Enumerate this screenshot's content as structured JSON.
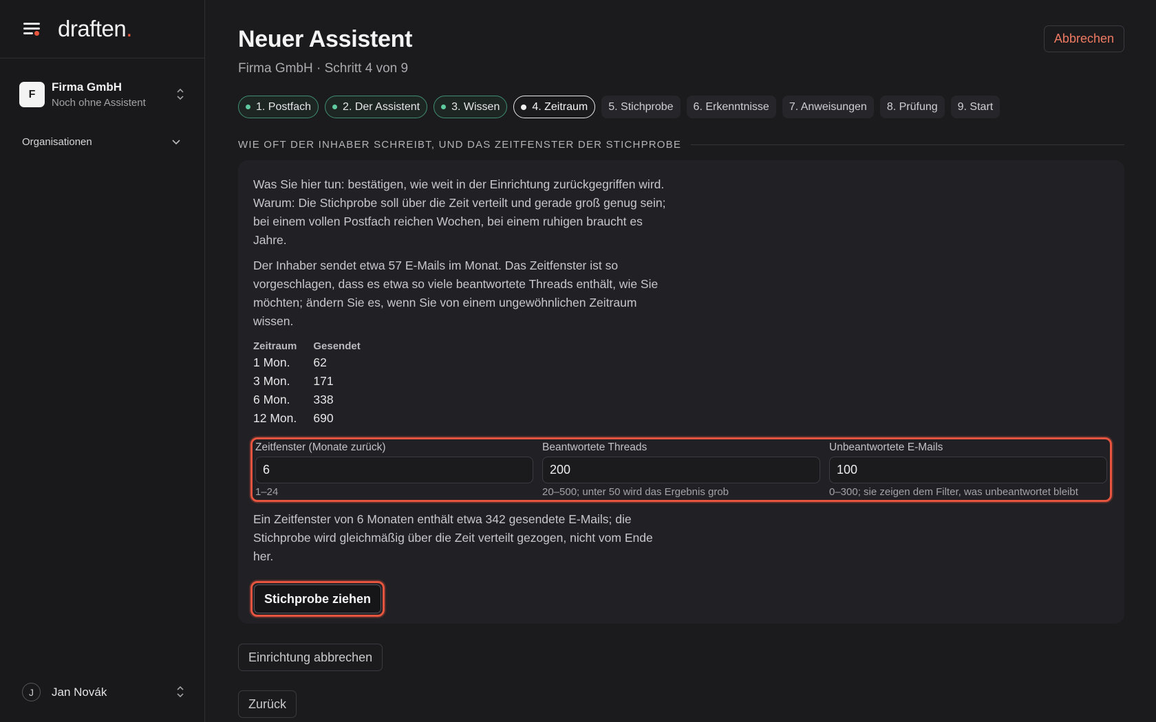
{
  "sidebar": {
    "brand": "draften",
    "brand_dot": ".",
    "org": {
      "initial": "F",
      "name": "Firma GmbH",
      "subtitle": "Noch ohne Assistent"
    },
    "nav_group": "Organisationen",
    "user": {
      "initial": "J",
      "name": "Jan Novák"
    }
  },
  "header": {
    "title": "Neuer Assistent",
    "subtitle": "Firma GmbH · Schritt 4 von 9",
    "cancel_label": "Abbrechen"
  },
  "steps": [
    {
      "label": "1. Postfach",
      "state": "done"
    },
    {
      "label": "2. Der Assistent",
      "state": "done"
    },
    {
      "label": "3. Wissen",
      "state": "done"
    },
    {
      "label": "4. Zeitraum",
      "state": "active"
    },
    {
      "label": "5. Stichprobe",
      "state": "pending"
    },
    {
      "label": "6. Erkenntnisse",
      "state": "pending"
    },
    {
      "label": "7. Anweisungen",
      "state": "pending"
    },
    {
      "label": "8. Prüfung",
      "state": "pending"
    },
    {
      "label": "9. Start",
      "state": "pending"
    }
  ],
  "section": {
    "heading": "WIE OFT DER INHABER SCHREIBT, UND DAS ZEITFENSTER DER STICHPROBE",
    "intro": "Was Sie hier tun: bestätigen, wie weit in der Einrichtung zurückgegriffen wird. Warum: Die Stichprobe soll über die Zeit verteilt und gerade groß genug sein; bei einem vollen Postfach reichen Wochen, bei einem ruhigen braucht es Jahre.",
    "volume_note": "Der Inhaber sendet etwa 57 E-Mails im Monat. Das Zeitfenster ist so vorgeschlagen, dass es etwa so viele beantwortete Threads enthält, wie Sie möchten; ändern Sie es, wenn Sie von einem ungewöhnlichen Zeitraum wissen.",
    "table": {
      "headers": [
        "Zeitraum",
        "Gesendet"
      ],
      "rows": [
        [
          "1 Mon.",
          "62"
        ],
        [
          "3 Mon.",
          "171"
        ],
        [
          "6 Mon.",
          "338"
        ],
        [
          "12 Mon.",
          "690"
        ]
      ]
    },
    "fields": {
      "window": {
        "label": "Zeitfenster (Monate zurück)",
        "value": "6",
        "hint": "1–24"
      },
      "answered": {
        "label": "Beantwortete Threads",
        "value": "200",
        "hint": "20–500; unter 50 wird das Ergebnis grob"
      },
      "unanswered": {
        "label": "Unbeantwortete E-Mails",
        "value": "100",
        "hint": "0–300; sie zeigen dem Filter, was unbeantwortet bleibt"
      }
    },
    "summary": "Ein Zeitfenster von 6 Monaten enthält etwa 342 gesendete E-Mails; die Stichprobe wird gleichmäßig über die Zeit verteilt gezogen, nicht vom Ende her.",
    "primary_label": "Stichprobe ziehen"
  },
  "footer": {
    "abort_label": "Einrichtung abbrechen",
    "back_label": "Zurück"
  },
  "colors": {
    "accent": "#e8553f",
    "done_step": "#5fc9a0",
    "background": "#1b1b1e"
  }
}
